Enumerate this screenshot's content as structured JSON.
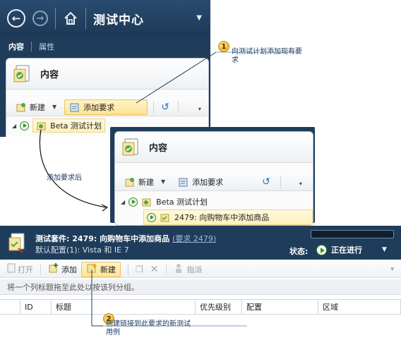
{
  "panel1": {
    "title": "测试中心",
    "tabs": [
      "内容",
      "属性"
    ],
    "card_title": "内容",
    "toolbar": {
      "new_label": "新建",
      "add_req_label": "添加要求"
    },
    "tree": {
      "plan_label": "Beta 测试计划"
    }
  },
  "panel2": {
    "card_title": "内容",
    "toolbar": {
      "new_label": "新建",
      "add_req_label": "添加要求"
    },
    "tree": {
      "plan_label": "Beta 测试计划",
      "child_label": "2479: 向购物车中添加商品"
    }
  },
  "panel3": {
    "suite_prefix": "测试套件: 2479: 向购物车中添加商品",
    "suite_link": "(要求 2479)",
    "default_config": "默认配置(1): Vista 和 IE 7",
    "status_label": "状态:",
    "status_value": "正在进行",
    "toolbar": {
      "open": "打开",
      "add": "添加",
      "new": "新建",
      "assign": "指派"
    },
    "group_hint": "将一个列标题拖至此处以按该列分组。",
    "columns": [
      "ID",
      "标题",
      "优先级别",
      "配置",
      "区域"
    ]
  },
  "callouts": {
    "c1_num": "1",
    "c1_text": "向测试计划添加现有要求",
    "c2_num": "2",
    "c2_text": "创建链接到此要求的新测试用例",
    "mid_text": "添加要求后"
  },
  "colors": {
    "header_bg": "#1f3d5b",
    "highlight": "#ffe494",
    "callout_line": "#1f3c63",
    "play_green": "#3b8a2d"
  }
}
